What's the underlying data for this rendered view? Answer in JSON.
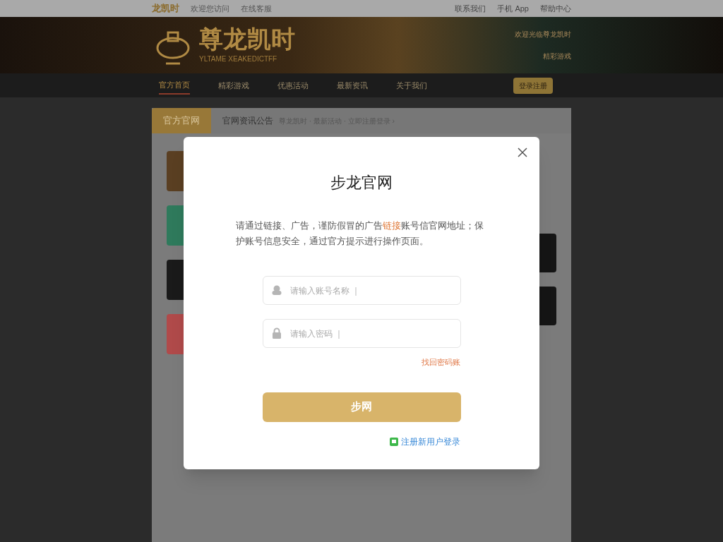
{
  "top_bar": {
    "logo_text": "龙凯时",
    "links": [
      "欢迎您访问",
      "在线客服"
    ],
    "right_links": [
      "联系我们",
      "手机 App",
      "帮助中心"
    ]
  },
  "banner": {
    "title": "尊龙凯时",
    "subtitle": "YLTAME XEAKEDICTFF",
    "side_texts": [
      "欢迎光临尊龙凯时",
      "精彩游戏"
    ]
  },
  "nav": {
    "items": [
      {
        "label": "官方首页",
        "selected": true
      },
      {
        "label": "精彩游戏",
        "selected": false
      },
      {
        "label": "优惠活动",
        "selected": false
      },
      {
        "label": "最新资讯",
        "selected": false
      },
      {
        "label": "关于我们",
        "selected": false
      }
    ],
    "button": "登录注册"
  },
  "panel": {
    "tab": "官方官网",
    "breadcrumb_title": "官网资讯公告",
    "breadcrumb": "尊龙凯时 · 最新活动 · 立即注册登录 ›",
    "left_cards": [
      {
        "color": "#5a3f22"
      },
      {
        "color": "#2f7a5c"
      },
      {
        "color": "#1a1a1a"
      },
      {
        "color": "#b04a4a"
      }
    ],
    "right_cards": [
      {
        "color": "#151515"
      },
      {
        "color": "#151515"
      }
    ]
  },
  "dialog": {
    "title": "步龙官网",
    "notice_before": "请通过链接、广告，谨防假冒的广告",
    "notice_highlight": "链接",
    "notice_after": "账号信官网地址；保护账号信息安全，通过官方提示进行操作页面。",
    "fields": [
      {
        "kind": "user",
        "placeholder": "请输入账号名称 ｜"
      },
      {
        "kind": "lock",
        "placeholder": "请输入密码 ｜"
      }
    ],
    "forgot": "找回密码账",
    "submit": "步网",
    "register": "注册新用户登录"
  }
}
